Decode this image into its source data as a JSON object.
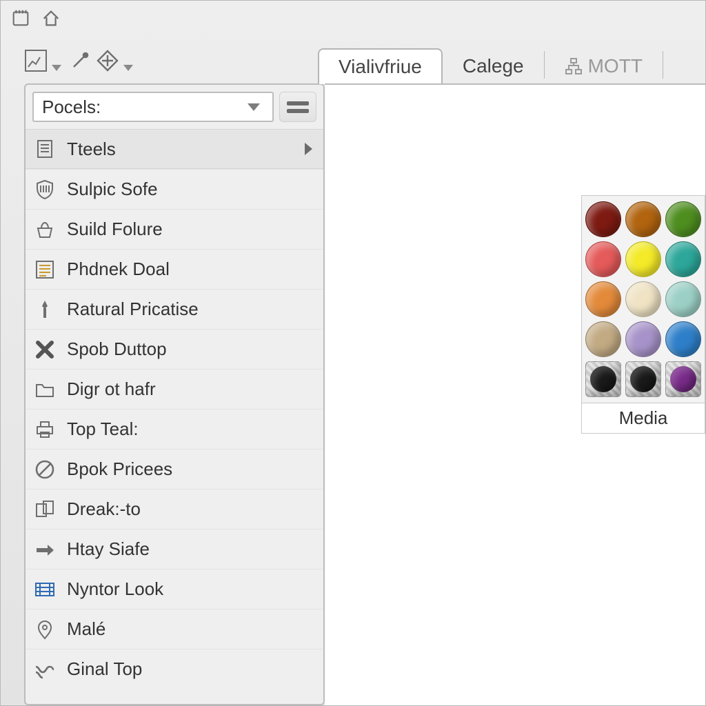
{
  "toolbar": {
    "combo_label": "Pocels:"
  },
  "tabs": [
    {
      "label": "Vialivfriue",
      "active": true
    },
    {
      "label": "Calege",
      "active": false
    },
    {
      "label": "MOTT",
      "active": false
    }
  ],
  "sidebar": {
    "items": [
      {
        "label": "Tteels",
        "icon": "document-icon",
        "selected": true,
        "expandable": true
      },
      {
        "label": "Sulpic Sofe",
        "icon": "shield-icon"
      },
      {
        "label": "Suild Folure",
        "icon": "basket-icon"
      },
      {
        "label": "Phdnek Doal",
        "icon": "lines-icon"
      },
      {
        "label": "Ratural Pricatise",
        "icon": "pen-icon"
      },
      {
        "label": "Spob Duttop",
        "icon": "x-icon"
      },
      {
        "label": "Digr ot hafr",
        "icon": "folder-icon"
      },
      {
        "label": "Top Teal:",
        "icon": "printer-icon"
      },
      {
        "label": "Bpok Pricees",
        "icon": "ban-icon"
      },
      {
        "label": "Dreak:-to",
        "icon": "cards-icon"
      },
      {
        "label": "Htay Siafe",
        "icon": "arrow-icon"
      },
      {
        "label": "Nyntor Look",
        "icon": "film-icon"
      },
      {
        "label": "Malé",
        "icon": "pin-icon"
      },
      {
        "label": "Ginal Top",
        "icon": "wave-icon"
      }
    ]
  },
  "palette": {
    "label": "Media",
    "swatches": [
      "#7d1a12",
      "#b2640f",
      "#4e8e1f",
      "#e55a5a",
      "#f4ea28",
      "#2ca79a",
      "#e38a3a",
      "#efe3c4",
      "#9cd0c6",
      "#c2aa83",
      "#a793c9",
      "#2e7fc9"
    ],
    "pattern_swatches": [
      "#1a1a1a",
      "#1a1a1a",
      "#7a2b8a"
    ]
  }
}
